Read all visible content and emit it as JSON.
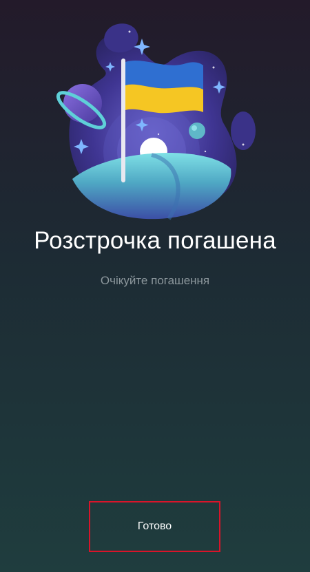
{
  "screen": {
    "title": "Розстрочка погашена",
    "subtitle": "Очікуйте погашення"
  },
  "illustration": {
    "icon": "ukraine-flag-planet-icon",
    "colors": {
      "flag_blue": "#2f6fd1",
      "flag_yellow": "#f5c623",
      "planet": "#4a3f9c",
      "ring": "#5fd0d8"
    }
  },
  "actions": {
    "done_label": "Готово"
  },
  "colors": {
    "background_top": "#231a2a",
    "background_bottom": "#1f3d3e",
    "highlight_border": "#d9142a",
    "subtitle": "#8c979c"
  }
}
